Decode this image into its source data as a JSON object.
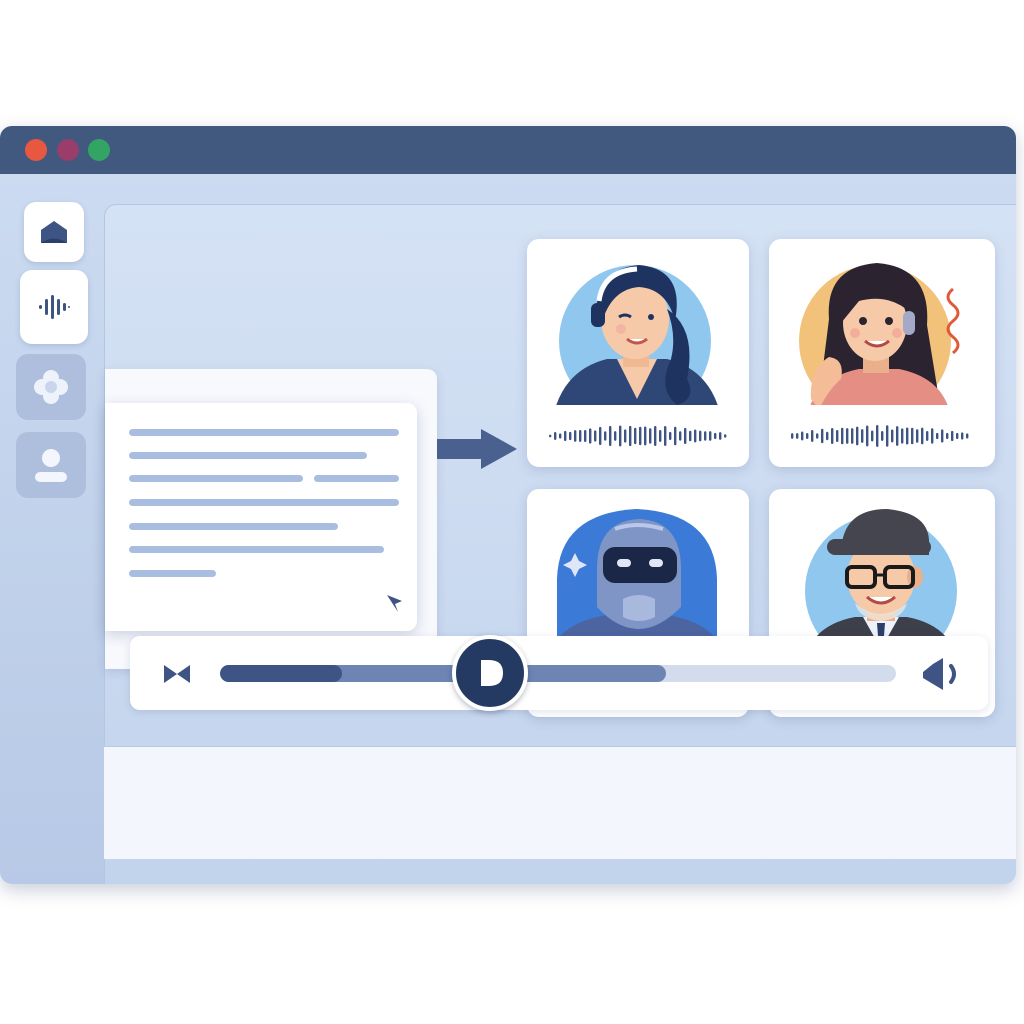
{
  "colors": {
    "titlebar": "#41597f",
    "accent_dark": "#243a63",
    "wave": "#3d5485",
    "traffic_red": "#e8573f",
    "traffic_purple": "#9a3d6a",
    "traffic_green": "#32a564"
  },
  "sidebar": {
    "items": [
      {
        "icon": "home-icon",
        "active": true
      },
      {
        "icon": "waveform-icon",
        "active": true
      },
      {
        "icon": "flower-icon",
        "active": false
      },
      {
        "icon": "user-icon",
        "active": false
      }
    ]
  },
  "document": {
    "icon": "cursor-icon"
  },
  "flow": {
    "icon": "arrow-right-icon"
  },
  "voices": [
    {
      "avatar": "woman-with-headset",
      "icon": "waveform"
    },
    {
      "avatar": "woman-long-hair-with-earpiece",
      "icon": "waveform"
    },
    {
      "avatar": "robot-helmet",
      "icon": "waveform"
    },
    {
      "avatar": "man-cap-glasses",
      "icon": "waveform"
    }
  ],
  "player": {
    "progress": 0.18,
    "buffered": 0.66,
    "playhead": 0.4,
    "icons": [
      "rewind-icon",
      "play-icon",
      "volume-icon"
    ]
  }
}
